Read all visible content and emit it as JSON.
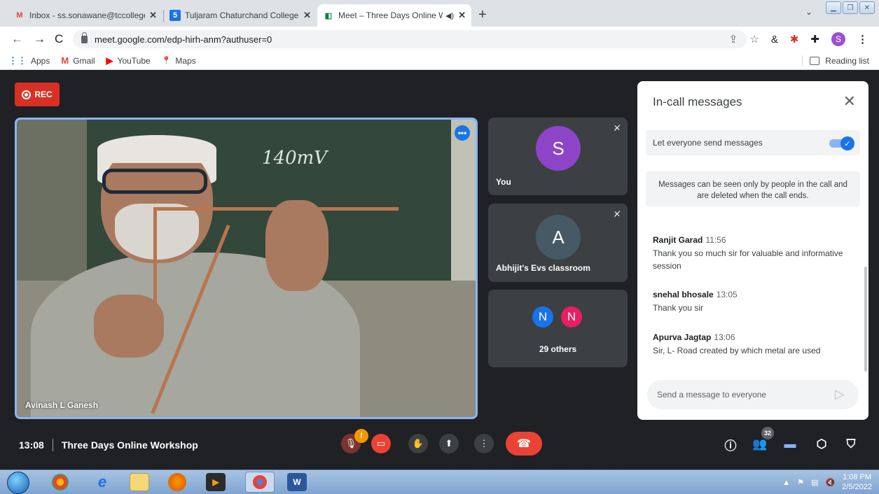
{
  "browser": {
    "tabs": [
      {
        "title": "Inbox - ss.sonawane@tccollege.c",
        "favicon": "gmail-icon",
        "favicon_glyph": "M"
      },
      {
        "title": "Tuljaram Chaturchand College of",
        "favicon": "college-site-icon",
        "favicon_glyph": "5"
      },
      {
        "title": "Meet – Three Days Online W",
        "favicon": "meet-icon",
        "favicon_glyph": "◧",
        "active": true
      }
    ],
    "url": "meet.google.com/edp-hirh-anm?authuser=0",
    "profile_initial": "S",
    "bookmarks": [
      {
        "label": "Apps",
        "icon": "apps-grid-icon",
        "glyph": "⋮⋮",
        "color": "#1a73e8"
      },
      {
        "label": "Gmail",
        "icon": "gmail-icon",
        "glyph": "M",
        "color": "#ea4335"
      },
      {
        "label": "YouTube",
        "icon": "youtube-icon",
        "glyph": "▶",
        "color": "#ff0000"
      },
      {
        "label": "Maps",
        "icon": "maps-icon",
        "glyph": "📍",
        "color": "#34a853"
      }
    ],
    "reading_list": "Reading list"
  },
  "meet": {
    "rec_label": "REC",
    "main_speaker": "Avinash L Ganesh",
    "chalk_text": "140mV",
    "tiles": [
      {
        "initial": "S",
        "name": "You",
        "color": "#8e44c9"
      },
      {
        "initial": "A",
        "name": "Abhijit's Evs classroom",
        "color": "#455a64"
      }
    ],
    "others": {
      "initials": [
        "N",
        "N"
      ],
      "colors": [
        "#1a73e8",
        "#e91e63"
      ],
      "label": "29 others"
    },
    "chat": {
      "title": "In-call messages",
      "toggle_label": "Let everyone send messages",
      "toggle_on": true,
      "note": "Messages can be seen only by people in the call and are deleted when the call ends.",
      "messages": [
        {
          "sender": "Ranjit Garad",
          "time": "11:56",
          "text": "Thank you so much sir for valuable and informative session"
        },
        {
          "sender": "snehal bhosale",
          "time": "13:05",
          "text": "Thank you sir"
        },
        {
          "sender": "Apurva Jagtap",
          "time": "13:06",
          "text": "Sir, L- Road created by which metal are  used"
        }
      ],
      "input_placeholder": "Send a message to everyone"
    },
    "bottom": {
      "time": "13:08",
      "meeting_name": "Three Days Online Workshop",
      "mic_warning": "!",
      "people_count": "32"
    }
  },
  "taskbar": {
    "clock_time": "1:08 PM",
    "clock_date": "2/5/2022"
  }
}
